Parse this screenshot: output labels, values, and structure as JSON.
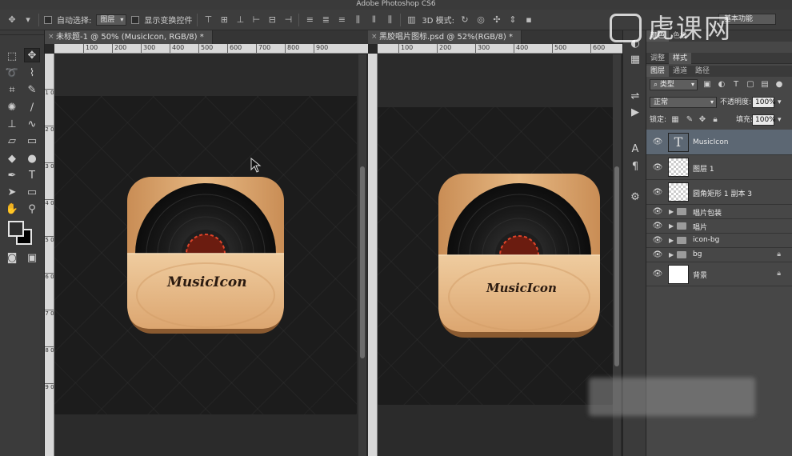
{
  "app_title": "Adobe Photoshop CS6",
  "options_bar": {
    "auto_select_label": "自动选择:",
    "auto_select_value": "图层",
    "show_transform_label": "显示变换控件",
    "mode_3d_label": "3D 模式:",
    "workspace_value": "基本功能"
  },
  "documents": [
    {
      "tab_title": "未标题-1 @ 50% (MusicIcon, RGB/8) *",
      "ruler_ticks": [
        "100",
        "200",
        "300",
        "400",
        "500",
        "600",
        "700",
        "800",
        "900"
      ],
      "vruler_ticks": [
        "1 0",
        "2 0",
        "3 0",
        "4 0",
        "5 0",
        "6 0",
        "7 0",
        "8 0",
        "9 0"
      ],
      "icon_text": "MusicIcon"
    },
    {
      "tab_title": "黑胶唱片图标.psd @ 52%(RGB/8) *",
      "ruler_ticks": [
        "100",
        "200",
        "300",
        "400",
        "500",
        "600"
      ],
      "icon_text": "MusicIcon"
    }
  ],
  "panels": {
    "top_tabs": [
      "颜色",
      "色板"
    ],
    "adjust_tabs": [
      "调整",
      "样式"
    ],
    "layer_tabs": [
      "图层",
      "通道",
      "路径"
    ],
    "filter_kind": "类型",
    "blend_mode": "正常",
    "opacity_label": "不透明度:",
    "opacity_value": "100%",
    "lock_label": "锁定:",
    "fill_label": "填充:",
    "fill_value": "100%"
  },
  "layers": [
    {
      "name": "MusicIcon",
      "kind": "text",
      "selected": true
    },
    {
      "name": "图层 1",
      "kind": "pixel"
    },
    {
      "name": "圆角矩形 1 副本 3",
      "kind": "shape"
    },
    {
      "name": "唱片包装",
      "kind": "group"
    },
    {
      "name": "唱片",
      "kind": "group"
    },
    {
      "name": "icon-bg",
      "kind": "group"
    },
    {
      "name": "bg",
      "kind": "group",
      "locked": true
    },
    {
      "name": "背景",
      "kind": "background",
      "locked": true
    }
  ],
  "watermark": {
    "text": "虎课网"
  },
  "colors": {
    "ui_dark": "#282828",
    "panel": "#474747",
    "selected_layer": "#5c6773",
    "wood": "#d9a874",
    "sleeve": "#e8c295"
  }
}
